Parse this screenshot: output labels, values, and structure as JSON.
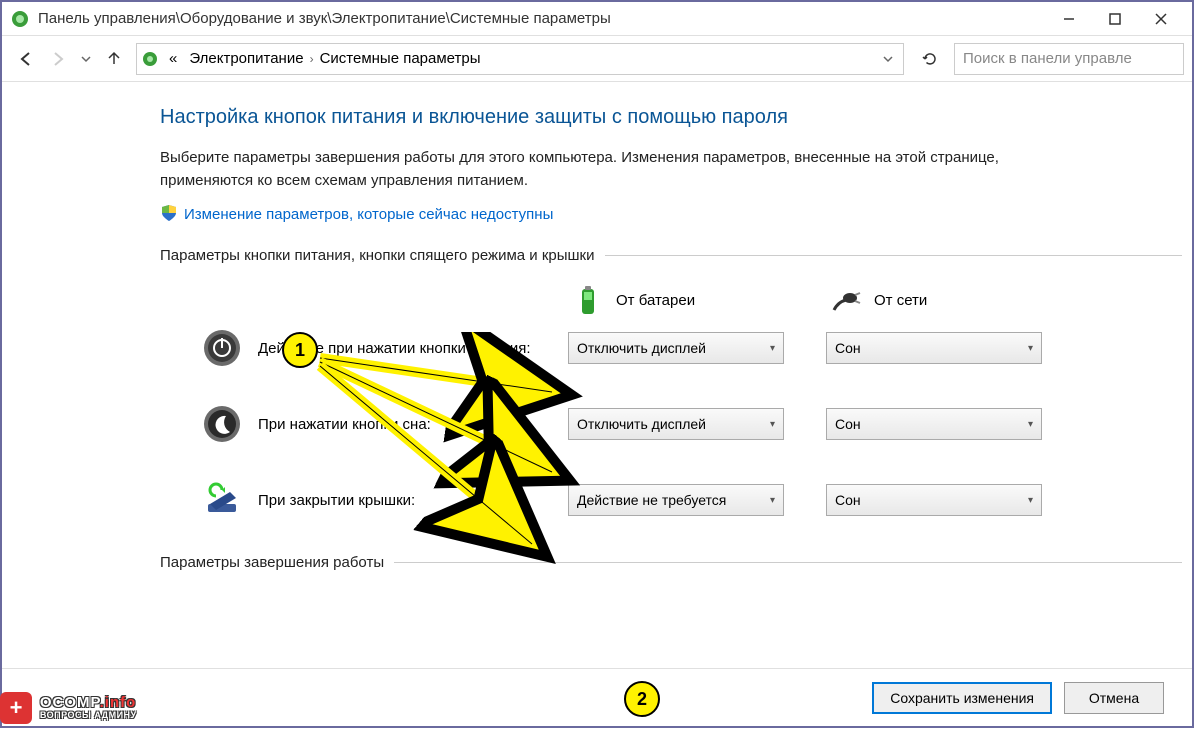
{
  "title_path": "Панель управления\\Оборудование и звук\\Электропитание\\Системные параметры",
  "breadcrumb": {
    "item1": "Электропитание",
    "item2": "Системные параметры"
  },
  "search_placeholder": "Поиск в панели управле",
  "heading": "Настройка кнопок питания и включение защиты с помощью пароля",
  "description": "Выберите параметры завершения работы для этого компьютера. Изменения параметров, внесенные на этой странице, применяются ко всем схемам управления питанием.",
  "change_link": "Изменение параметров, которые сейчас недоступны",
  "section1": "Параметры кнопки питания, кнопки спящего режима и крышки",
  "columns": {
    "battery": "От батареи",
    "plugged": "От сети"
  },
  "rows": [
    {
      "label": "Действие при нажатии кнопки питания:",
      "battery": "Отключить дисплей",
      "plugged": "Сон"
    },
    {
      "label": "При нажатии кнопки сна:",
      "battery": "Отключить дисплей",
      "plugged": "Сон"
    },
    {
      "label": "При закрытии крышки:",
      "battery": "Действие не требуется",
      "plugged": "Сон"
    }
  ],
  "section2": "Параметры завершения работы",
  "buttons": {
    "save": "Сохранить изменения",
    "cancel": "Отмена"
  },
  "callouts": {
    "c1": "1",
    "c2": "2"
  },
  "logo": {
    "line1a": "OCOMP",
    "line1b": ".info",
    "line2": "ВОПРОСЫ АДМИНУ"
  }
}
